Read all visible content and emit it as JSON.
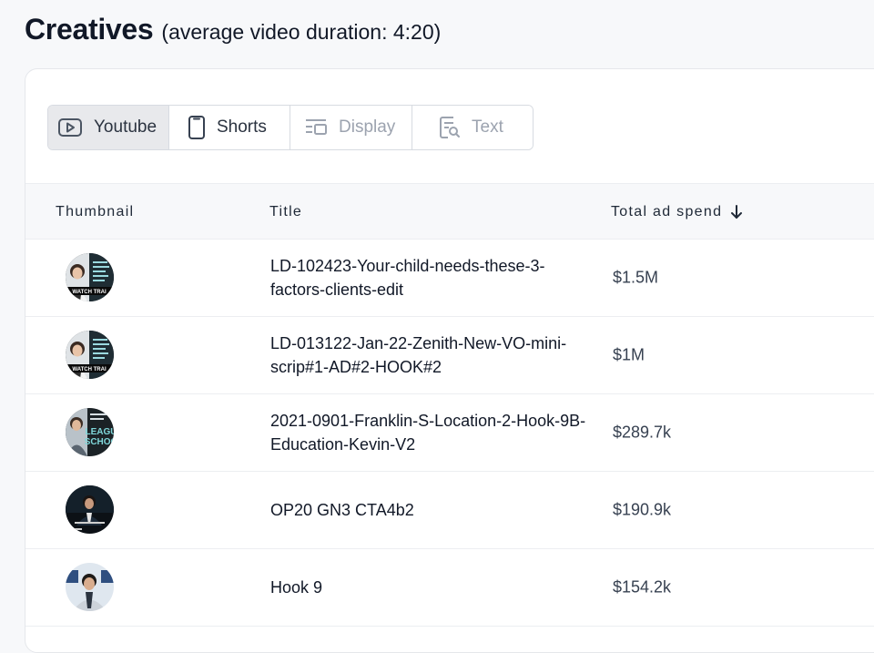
{
  "header": {
    "title": "Creatives",
    "subtitle": "(average video duration: 4:20)"
  },
  "tabs": [
    {
      "label": "Youtube",
      "icon": "youtube-play-icon",
      "state": "selected"
    },
    {
      "label": "Shorts",
      "icon": "phone-icon",
      "state": "enabled"
    },
    {
      "label": "Display",
      "icon": "display-layout-icon",
      "state": "disabled"
    },
    {
      "label": "Text",
      "icon": "text-search-icon",
      "state": "disabled"
    }
  ],
  "table": {
    "columns": {
      "thumbnail": "Thumbnail",
      "title": "Title",
      "spend": "Total ad spend"
    },
    "sort_icon": "arrow-down-icon",
    "rows": [
      {
        "title": "LD-102423-Your-child-needs-these-3-factors-clients-edit",
        "spend": "$1.5M",
        "thumb_text": [
          "WATCH TRAI"
        ]
      },
      {
        "title": "LD-013122-Jan-22-Zenith-New-VO-mini-scrip#1-AD#2-HOOK#2",
        "spend": "$1M",
        "thumb_text": [
          "WATCH TRAI"
        ]
      },
      {
        "title": "2021-0901-Franklin-S-Location-2-Hook-9B-Education-Kevin-V2",
        "spend": "$289.7k",
        "thumb_text": [
          "LEAGU",
          "SCHOO"
        ]
      },
      {
        "title": "OP20 GN3 CTA4b2",
        "spend": "$190.9k",
        "thumb_text": []
      },
      {
        "title": "Hook 9",
        "spend": "$154.2k",
        "thumb_text": []
      }
    ]
  },
  "colors": {
    "background": "#f7f8fa",
    "selected_tab": "#e8e9ec",
    "disabled_text": "#9ca3af",
    "teal_accent": "#7fd6d9"
  }
}
